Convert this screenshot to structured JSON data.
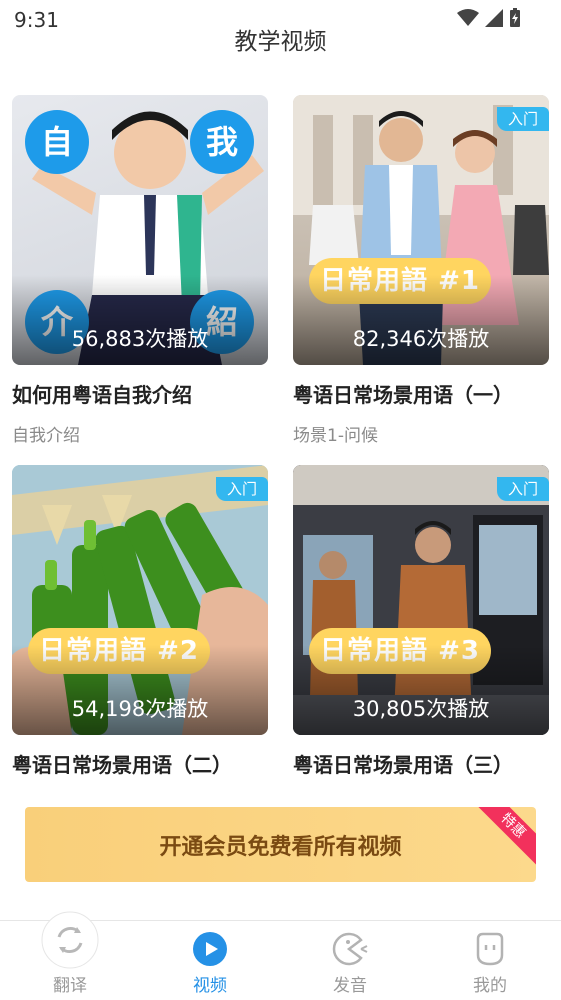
{
  "status": {
    "time": "9:31"
  },
  "header": {
    "title": "教学视频"
  },
  "videos": [
    {
      "title": "如何用粤语自我介绍",
      "subtitle": "自我介绍",
      "plays": "56,883次播放",
      "chars": [
        "自",
        "我",
        "介",
        "紹"
      ]
    },
    {
      "title": "粤语日常场景用语（一）",
      "subtitle": "场景1-问候",
      "plays": "82,346次播放",
      "tag": "入门",
      "pill": "日常用語 #1"
    },
    {
      "title": "粤语日常场景用语（二）",
      "plays": "54,198次播放",
      "tag": "入门",
      "pill": "日常用語 #2"
    },
    {
      "title": "粤语日常场景用语（三）",
      "plays": "30,805次播放",
      "tag": "入门",
      "pill": "日常用語 #3"
    }
  ],
  "vip": {
    "label": "开通会员免费看所有视频",
    "badge": "特惠"
  },
  "tabs": [
    {
      "label": "翻译",
      "icon": "refresh-icon"
    },
    {
      "label": "视频",
      "icon": "play-icon",
      "active": true
    },
    {
      "label": "发音",
      "icon": "pacman-icon"
    },
    {
      "label": "我的",
      "icon": "face-icon"
    }
  ],
  "colors": {
    "accent": "#2591e6",
    "tag": "#33b7ef",
    "pill": "#ffd560",
    "vip_start": "#f9cf7a",
    "vip_text": "#7a4a12",
    "ribbon": "#f2315c"
  }
}
